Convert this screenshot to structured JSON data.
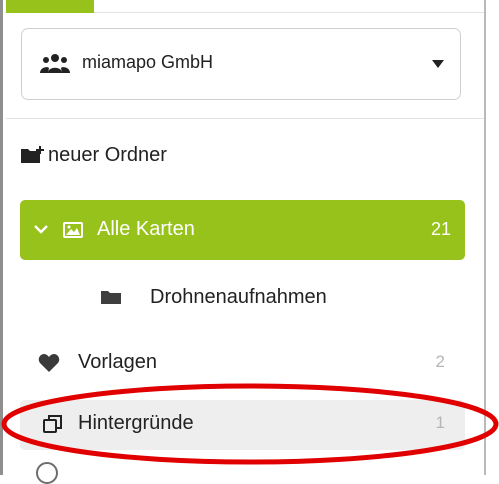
{
  "org_selector": {
    "name": "miamapo GmbH",
    "icon": "users-icon",
    "caret_icon": "caret-down-icon"
  },
  "actions": {
    "new_folder_label": "neuer Ordner",
    "new_folder_icon": "folder-plus-icon"
  },
  "folders": [
    {
      "label": "Alle Karten",
      "count": "21",
      "icon": "image-icon",
      "expanded": true,
      "selected": true
    },
    {
      "label": "Drohnenaufnahmen",
      "icon": "folder-icon"
    },
    {
      "label": "Vorlagen",
      "count": "2",
      "icon": "heart-icon"
    },
    {
      "label": "Hintergründe",
      "count": "1",
      "icon": "copy-icon",
      "highlighted": true
    }
  ],
  "colors": {
    "accent": "#97c21c",
    "annotation": "#e00000",
    "highlight_row": "#eeeeee",
    "muted_count": "#b5b5b5"
  }
}
